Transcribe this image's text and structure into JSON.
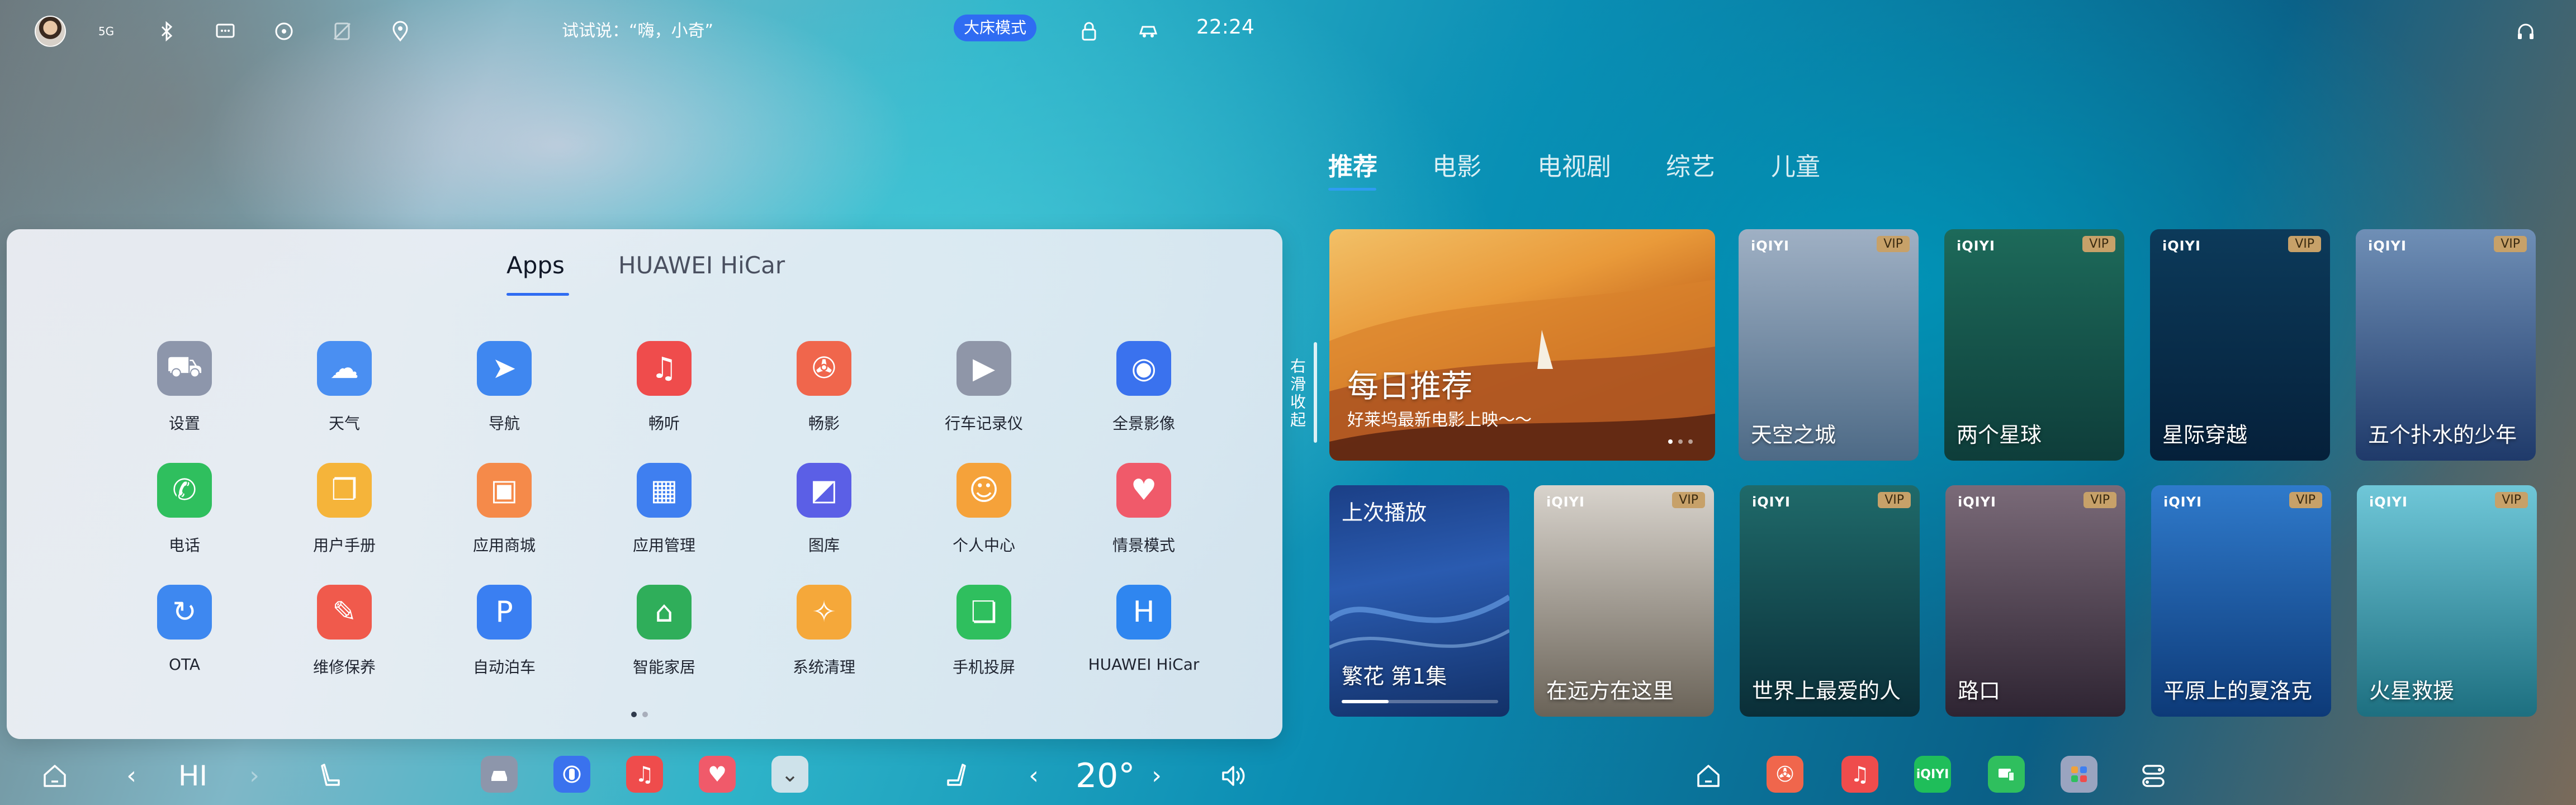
{
  "status_bar": {
    "signal": "5G",
    "voice_hint": "试试说：“嗨，小奇”",
    "mode_badge": "大床模式",
    "time": "22:24"
  },
  "apps_panel": {
    "tabs": [
      "Apps",
      "HUAWEI HiCar"
    ],
    "active_tab": 0,
    "apps": [
      {
        "label": "设置",
        "icon": "car-settings-icon",
        "color": "#8d96ab"
      },
      {
        "label": "天气",
        "icon": "weather-icon",
        "color": "#4a8ff2"
      },
      {
        "label": "导航",
        "icon": "navigation-icon",
        "color": "#3f87f0"
      },
      {
        "label": "畅听",
        "icon": "music-icon",
        "color": "#ef4c4c"
      },
      {
        "label": "畅影",
        "icon": "film-reel-icon",
        "color": "#f0664c"
      },
      {
        "label": "行车记录仪",
        "icon": "dashcam-icon",
        "color": "#8f96a8"
      },
      {
        "label": "全景影像",
        "icon": "panoramic-camera-icon",
        "color": "#3a72ee"
      },
      {
        "label": "电话",
        "icon": "phone-icon",
        "color": "#2fbf5e"
      },
      {
        "label": "用户手册",
        "icon": "manual-icon",
        "color": "#f5b43a"
      },
      {
        "label": "应用商城",
        "icon": "app-store-icon",
        "color": "#f58a4a"
      },
      {
        "label": "应用管理",
        "icon": "app-manage-icon",
        "color": "#3f7ff0"
      },
      {
        "label": "图库",
        "icon": "gallery-icon",
        "color": "#5b5fe6"
      },
      {
        "label": "个人中心",
        "icon": "user-center-icon",
        "color": "#f5a23a"
      },
      {
        "label": "情景模式",
        "icon": "scene-mode-icon",
        "color": "#f05a6a"
      },
      {
        "label": "OTA",
        "icon": "ota-update-icon",
        "color": "#3e88f0"
      },
      {
        "label": "维修保养",
        "icon": "wrench-icon",
        "color": "#f05a4c"
      },
      {
        "label": "自动泊车",
        "icon": "parking-icon",
        "color": "#3a7ff2"
      },
      {
        "label": "智能家居",
        "icon": "smart-home-icon",
        "color": "#2fae5a"
      },
      {
        "label": "系统清理",
        "icon": "cleaner-icon",
        "color": "#f5a83a"
      },
      {
        "label": "手机投屏",
        "icon": "phone-cast-icon",
        "color": "#2fbf5e"
      },
      {
        "label": "HUAWEI HiCar",
        "icon": "hicar-icon",
        "color": "#2f86f0"
      }
    ],
    "page_dots": 2,
    "active_page": 0
  },
  "content": {
    "tabs": [
      "推荐",
      "电影",
      "电视剧",
      "综艺",
      "儿童"
    ],
    "active_tab": 0,
    "side_label": "右滑收起",
    "daily": {
      "title": "每日推荐",
      "subtitle": "好莱坞最新电影上映～～"
    },
    "last_played": {
      "title": "上次播放",
      "episode": "繁花 第1集",
      "progress": 0.3
    },
    "brand": "iQIYI",
    "vip": "VIP",
    "row1": [
      "天空之城",
      "两个星球",
      "星际穿越",
      "五个扑水的少年"
    ],
    "row2": [
      "在远方在这里",
      "世界上最爱的人",
      "路口",
      "平原上的夏洛克",
      "火星救援"
    ]
  },
  "dock": {
    "assistant": "HI",
    "temperature": "20°"
  }
}
